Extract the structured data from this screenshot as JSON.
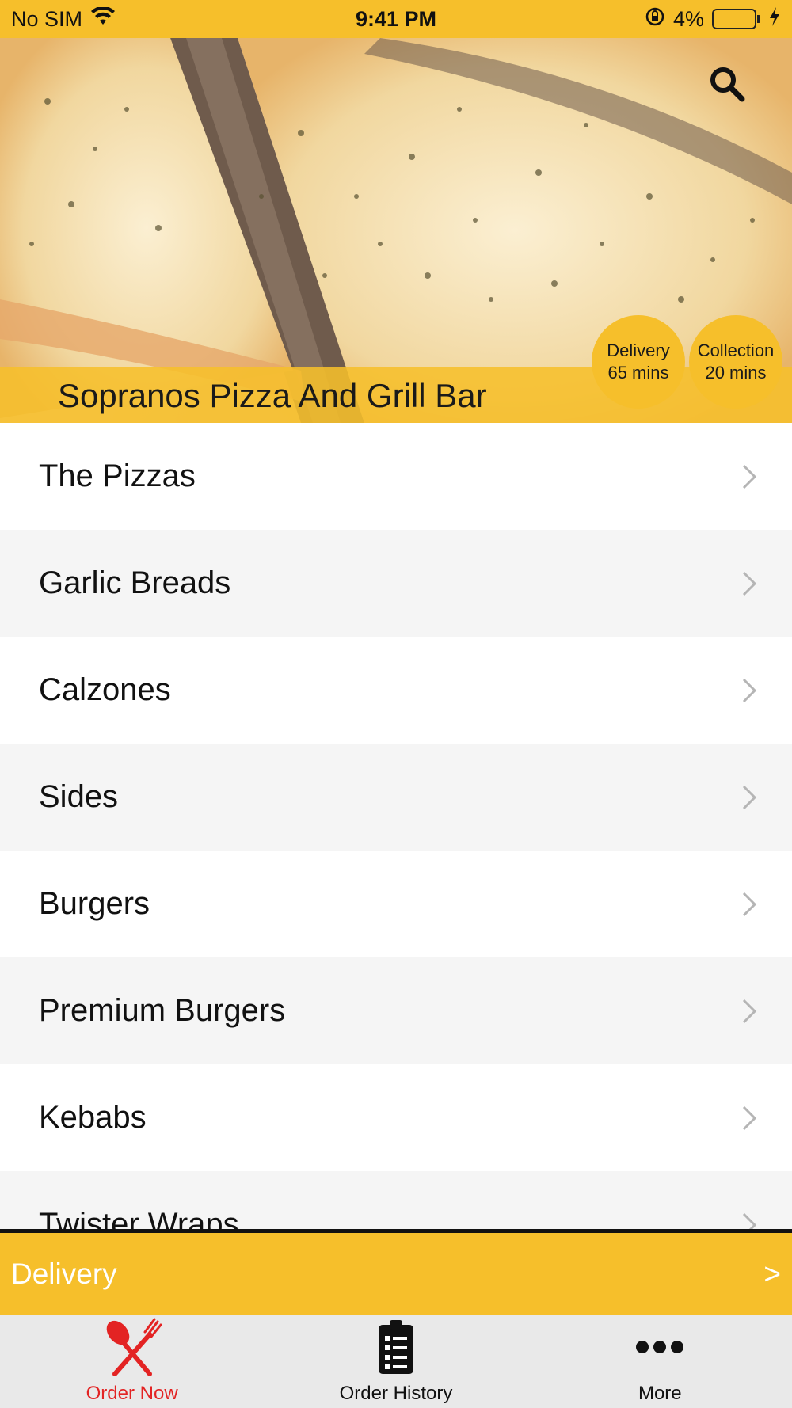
{
  "status_bar": {
    "carrier": "No SIM",
    "time": "9:41 PM",
    "battery_percent": "4%",
    "battery_level": 0.04,
    "icons": [
      "wifi-icon",
      "rotation-lock-icon",
      "battery-icon",
      "charging-bolt-icon"
    ]
  },
  "hero": {
    "restaurant_name": "Sopranos Pizza And Grill Bar",
    "badges": {
      "delivery": {
        "label": "Delivery",
        "time": "65 mins"
      },
      "collection": {
        "label": "Collection",
        "time": "20 mins"
      }
    },
    "search_icon": "search-icon"
  },
  "menu": {
    "items": [
      {
        "label": "The Pizzas"
      },
      {
        "label": "Garlic Breads"
      },
      {
        "label": "Calzones"
      },
      {
        "label": "Sides"
      },
      {
        "label": "Burgers"
      },
      {
        "label": "Premium Burgers"
      },
      {
        "label": "Kebabs"
      },
      {
        "label": "Twister Wraps"
      }
    ]
  },
  "delivery_bar": {
    "label": "Delivery",
    "arrow": ">"
  },
  "tabs": [
    {
      "label": "Order Now",
      "icon": "fork-knife-icon",
      "active": true
    },
    {
      "label": "Order History",
      "icon": "clipboard-icon",
      "active": false
    },
    {
      "label": "More",
      "icon": "more-dots-icon",
      "active": false
    }
  ],
  "colors": {
    "accent": "#f6bf2b",
    "active_tab": "#e32323",
    "list_alt": "#f5f5f5"
  }
}
